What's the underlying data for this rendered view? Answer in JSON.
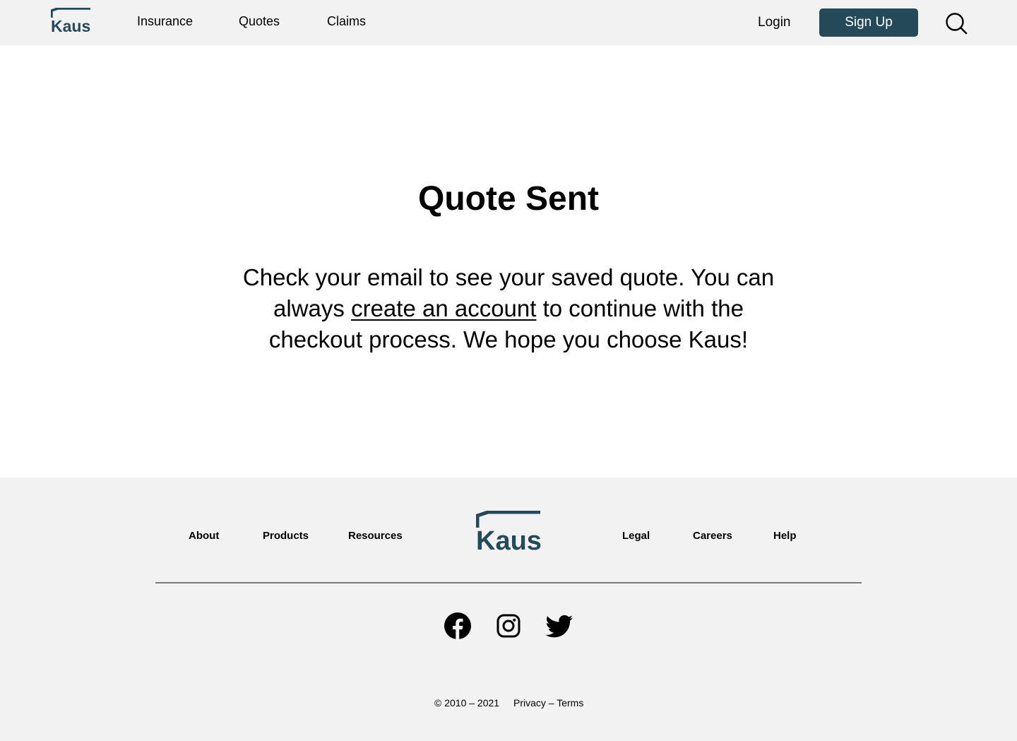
{
  "brand": {
    "name": "Kaus",
    "color": "#244a5a"
  },
  "header": {
    "nav": [
      {
        "label": "Insurance"
      },
      {
        "label": "Quotes"
      },
      {
        "label": "Claims"
      }
    ],
    "login_label": "Login",
    "signup_label": "Sign Up",
    "search_icon": "search-icon"
  },
  "main": {
    "title": "Quote Sent",
    "message_before": "Check your email to see your saved quote. You can always ",
    "message_link": "create an account",
    "message_after": " to continue with the checkout process. We hope you choose Kaus!"
  },
  "footer": {
    "left_links": [
      {
        "label": "About"
      },
      {
        "label": "Products"
      },
      {
        "label": "Resources"
      }
    ],
    "right_links": [
      {
        "label": "Legal"
      },
      {
        "label": "Careers"
      },
      {
        "label": "Help"
      }
    ],
    "social_icons": [
      "facebook-icon",
      "instagram-icon",
      "twitter-icon"
    ],
    "copyright": "© 2010 – 2021",
    "privacy_label": "Privacy",
    "separator": " – ",
    "terms_label": "Terms"
  },
  "colors": {
    "header_bg": "#f2f2f2",
    "footer_bg": "#f2f2f2",
    "button_bg": "#244a5a",
    "button_text": "#ffffff",
    "divider": "#7a7a7a"
  }
}
